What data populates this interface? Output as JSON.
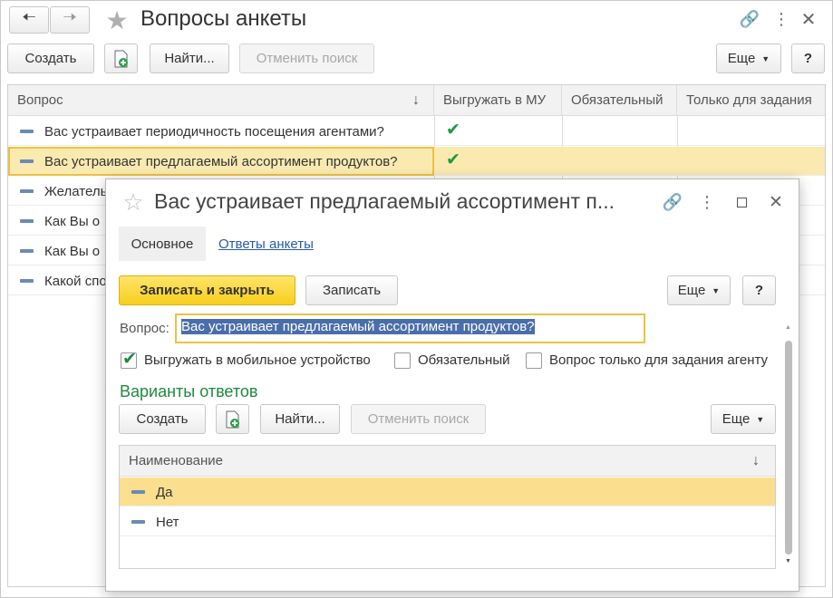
{
  "main": {
    "title": "Вопросы анкеты",
    "toolbar": {
      "create": "Создать",
      "find": "Найти...",
      "cancel_search": "Отменить поиск",
      "more": "Еще",
      "help": "?"
    },
    "columns": [
      "Вопрос",
      "Выгружать в МУ",
      "Обязательный",
      "Только для задания"
    ],
    "rows": [
      {
        "text": "Вас устраивает периодичность посещения агентами?",
        "export": true
      },
      {
        "text": "Вас устраивает предлагаемый ассортимент продуктов?",
        "export": true
      },
      {
        "text": "Желатель",
        "export": false
      },
      {
        "text": "Как Вы о",
        "export": false
      },
      {
        "text": "Как Вы о",
        "export": false
      },
      {
        "text": "Какой спо",
        "export": false
      }
    ]
  },
  "dialog": {
    "title": "Вас устраивает предлагаемый ассортимент п...",
    "tabs": {
      "main": "Основное",
      "answers": "Ответы анкеты"
    },
    "toolbar": {
      "save_close": "Записать и закрыть",
      "save": "Записать",
      "more": "Еще",
      "help": "?"
    },
    "question_label": "Вопрос:",
    "question_value": "Вас устраивает предлагаемый ассортимент продуктов?",
    "checkboxes": {
      "export_mobile": {
        "label": "Выгружать в мобильное устройство",
        "checked": true
      },
      "required": {
        "label": "Обязательный",
        "checked": false
      },
      "agent_only": {
        "label": "Вопрос только для задания агенту",
        "checked": false
      }
    },
    "answers_heading": "Варианты ответов",
    "answers_toolbar": {
      "create": "Создать",
      "find": "Найти...",
      "cancel_search": "Отменить поиск",
      "more": "Еще"
    },
    "answers_column": "Наименование",
    "answers": [
      "Да",
      "Нет"
    ]
  },
  "colors": {
    "accent_green": "#1f9a43",
    "selected_row": "#fbeab0",
    "primary_button": "#f7cf1c",
    "link": "#2a5aa8"
  }
}
